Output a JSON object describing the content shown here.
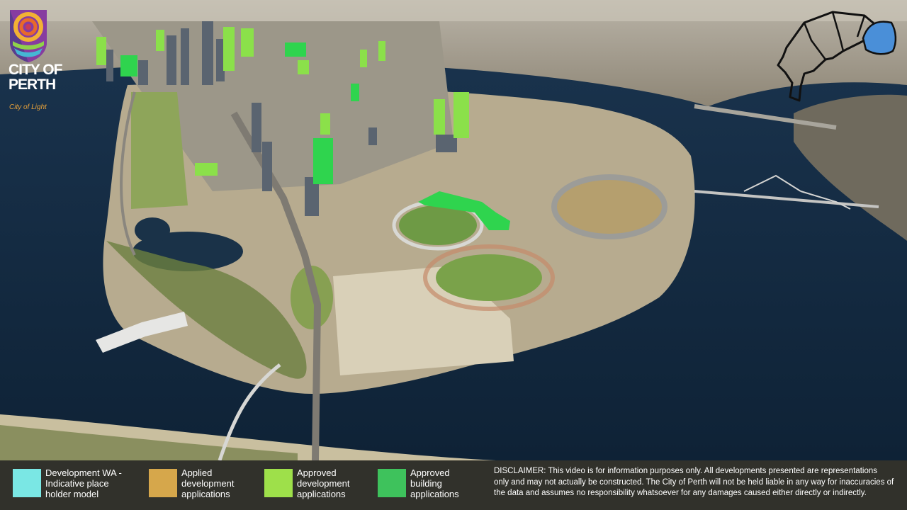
{
  "branding": {
    "city_name": "CITY OF PERTH",
    "tagline": "City of Light"
  },
  "legend": {
    "items": [
      {
        "label": "Development WA -\nIndicative place\nholder model",
        "color": "#7ae7e4"
      },
      {
        "label": "Applied\ndevelopment\napplications",
        "color": "#d6a74b"
      },
      {
        "label": "Approved\ndevelopment\napplications",
        "color": "#9ee04a"
      },
      {
        "label": "Approved\nbuilding\napplications",
        "color": "#3ec25c"
      }
    ]
  },
  "disclaimer": "DISCLAIMER: This video is for information purposes only.  All developments presented are representations only and may not actually be constructed. The City of Perth will not be held liable in any way for inaccuracies of the data and assumes no responsibility whatsoever for any damages caused either directly or indirectly.",
  "colors": {
    "water": "#122a40",
    "land": "#b7ab8f",
    "park": "#7c9a4a",
    "highlight_minimap": "#4a8fd8"
  },
  "icons": [
    "city-of-perth-logo-icon",
    "locator-minimap-icon"
  ]
}
